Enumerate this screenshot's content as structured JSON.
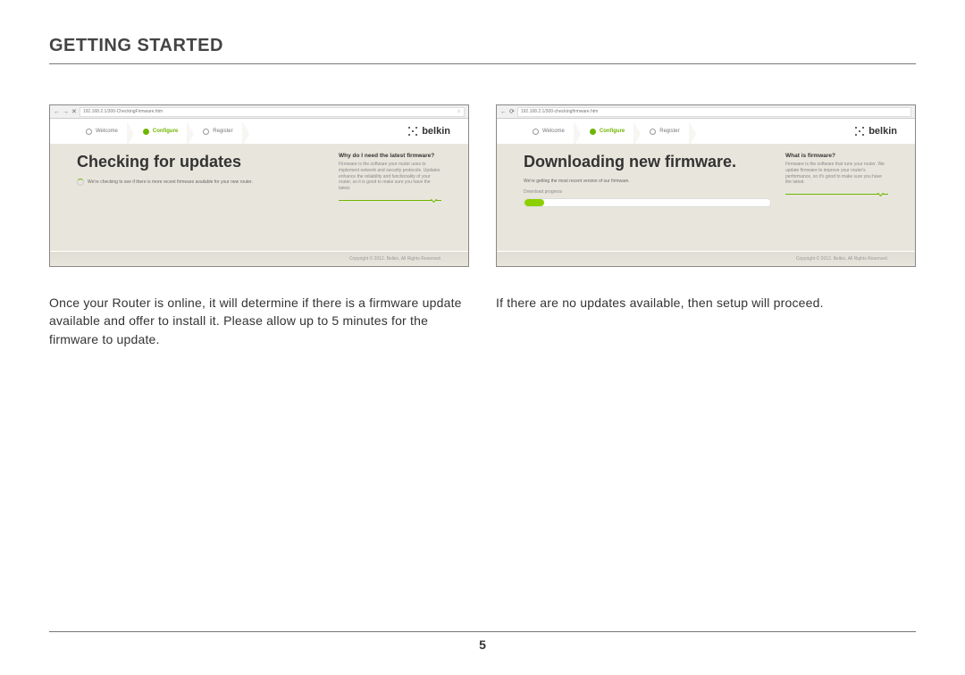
{
  "header": "GETTING STARTED",
  "pageNumber": "5",
  "left": {
    "url": "192.168.2.1/300-CheckingFirmware.htm",
    "crumbs": {
      "welcome": "Welcome",
      "configure": "Configure",
      "register": "Register"
    },
    "logo": "belkin",
    "title": "Checking for updates",
    "subline": "We're checking to see if there is more recent firmware available for your new router.",
    "sideTitle": "Why do I need the latest firmware?",
    "sideBody": "Firmware is the software your router uses to implement network and security protocols. Updates enhance the reliability and functionality of your router, so it is good to make sure you have the latest.",
    "footer": "Copyright © 2012. Belkin, All Rights Reserved.",
    "caption": "Once your Router is online, it will determine if there is a firmware update available and offer to install it. Please allow up to 5 minutes for the firmware to update."
  },
  "right": {
    "url": "192.168.2.1/300-checkingfirmware.htm",
    "crumbs": {
      "welcome": "Welcome",
      "configure": "Configure",
      "register": "Register"
    },
    "logo": "belkin",
    "title": "Downloading new firmware.",
    "subline": "We're getting the most recent version of our firmware.",
    "progressLabel": "Download progress",
    "sideTitle": "What is firmware?",
    "sideBody": "Firmware is the software that runs your router. We update firmware to improve your router's performance, so it's good to make sure you have the latest.",
    "footer": "Copyright © 2012. Belkin, All Rights Reserved.",
    "caption": "If there are no updates available, then setup will proceed."
  }
}
